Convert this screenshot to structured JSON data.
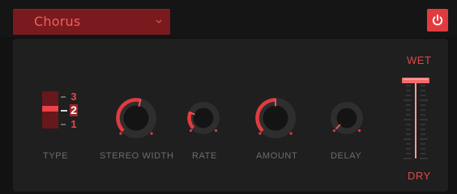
{
  "header": {
    "preset_label": "Chorus",
    "dropdown_icon": "chevron-down-icon",
    "power_icon": "power-icon"
  },
  "type_selector": {
    "label": "TYPE",
    "options": [
      "3",
      "2",
      "1"
    ],
    "selected": "2"
  },
  "knobs": [
    {
      "label": "STEREO WIDTH",
      "value": 0.55
    },
    {
      "label": "RATE",
      "value": 0.25
    },
    {
      "label": "AMOUNT",
      "value": 0.5
    },
    {
      "label": "DELAY",
      "value": 0.0
    }
  ],
  "mix_fader": {
    "top_label": "WET",
    "bottom_label": "DRY",
    "value": 1.0
  },
  "colors": {
    "accent": "#e23b3f",
    "accent_dark": "#7a1a1f",
    "panel": "#1f1f1f",
    "label": "#6d6d6d"
  }
}
